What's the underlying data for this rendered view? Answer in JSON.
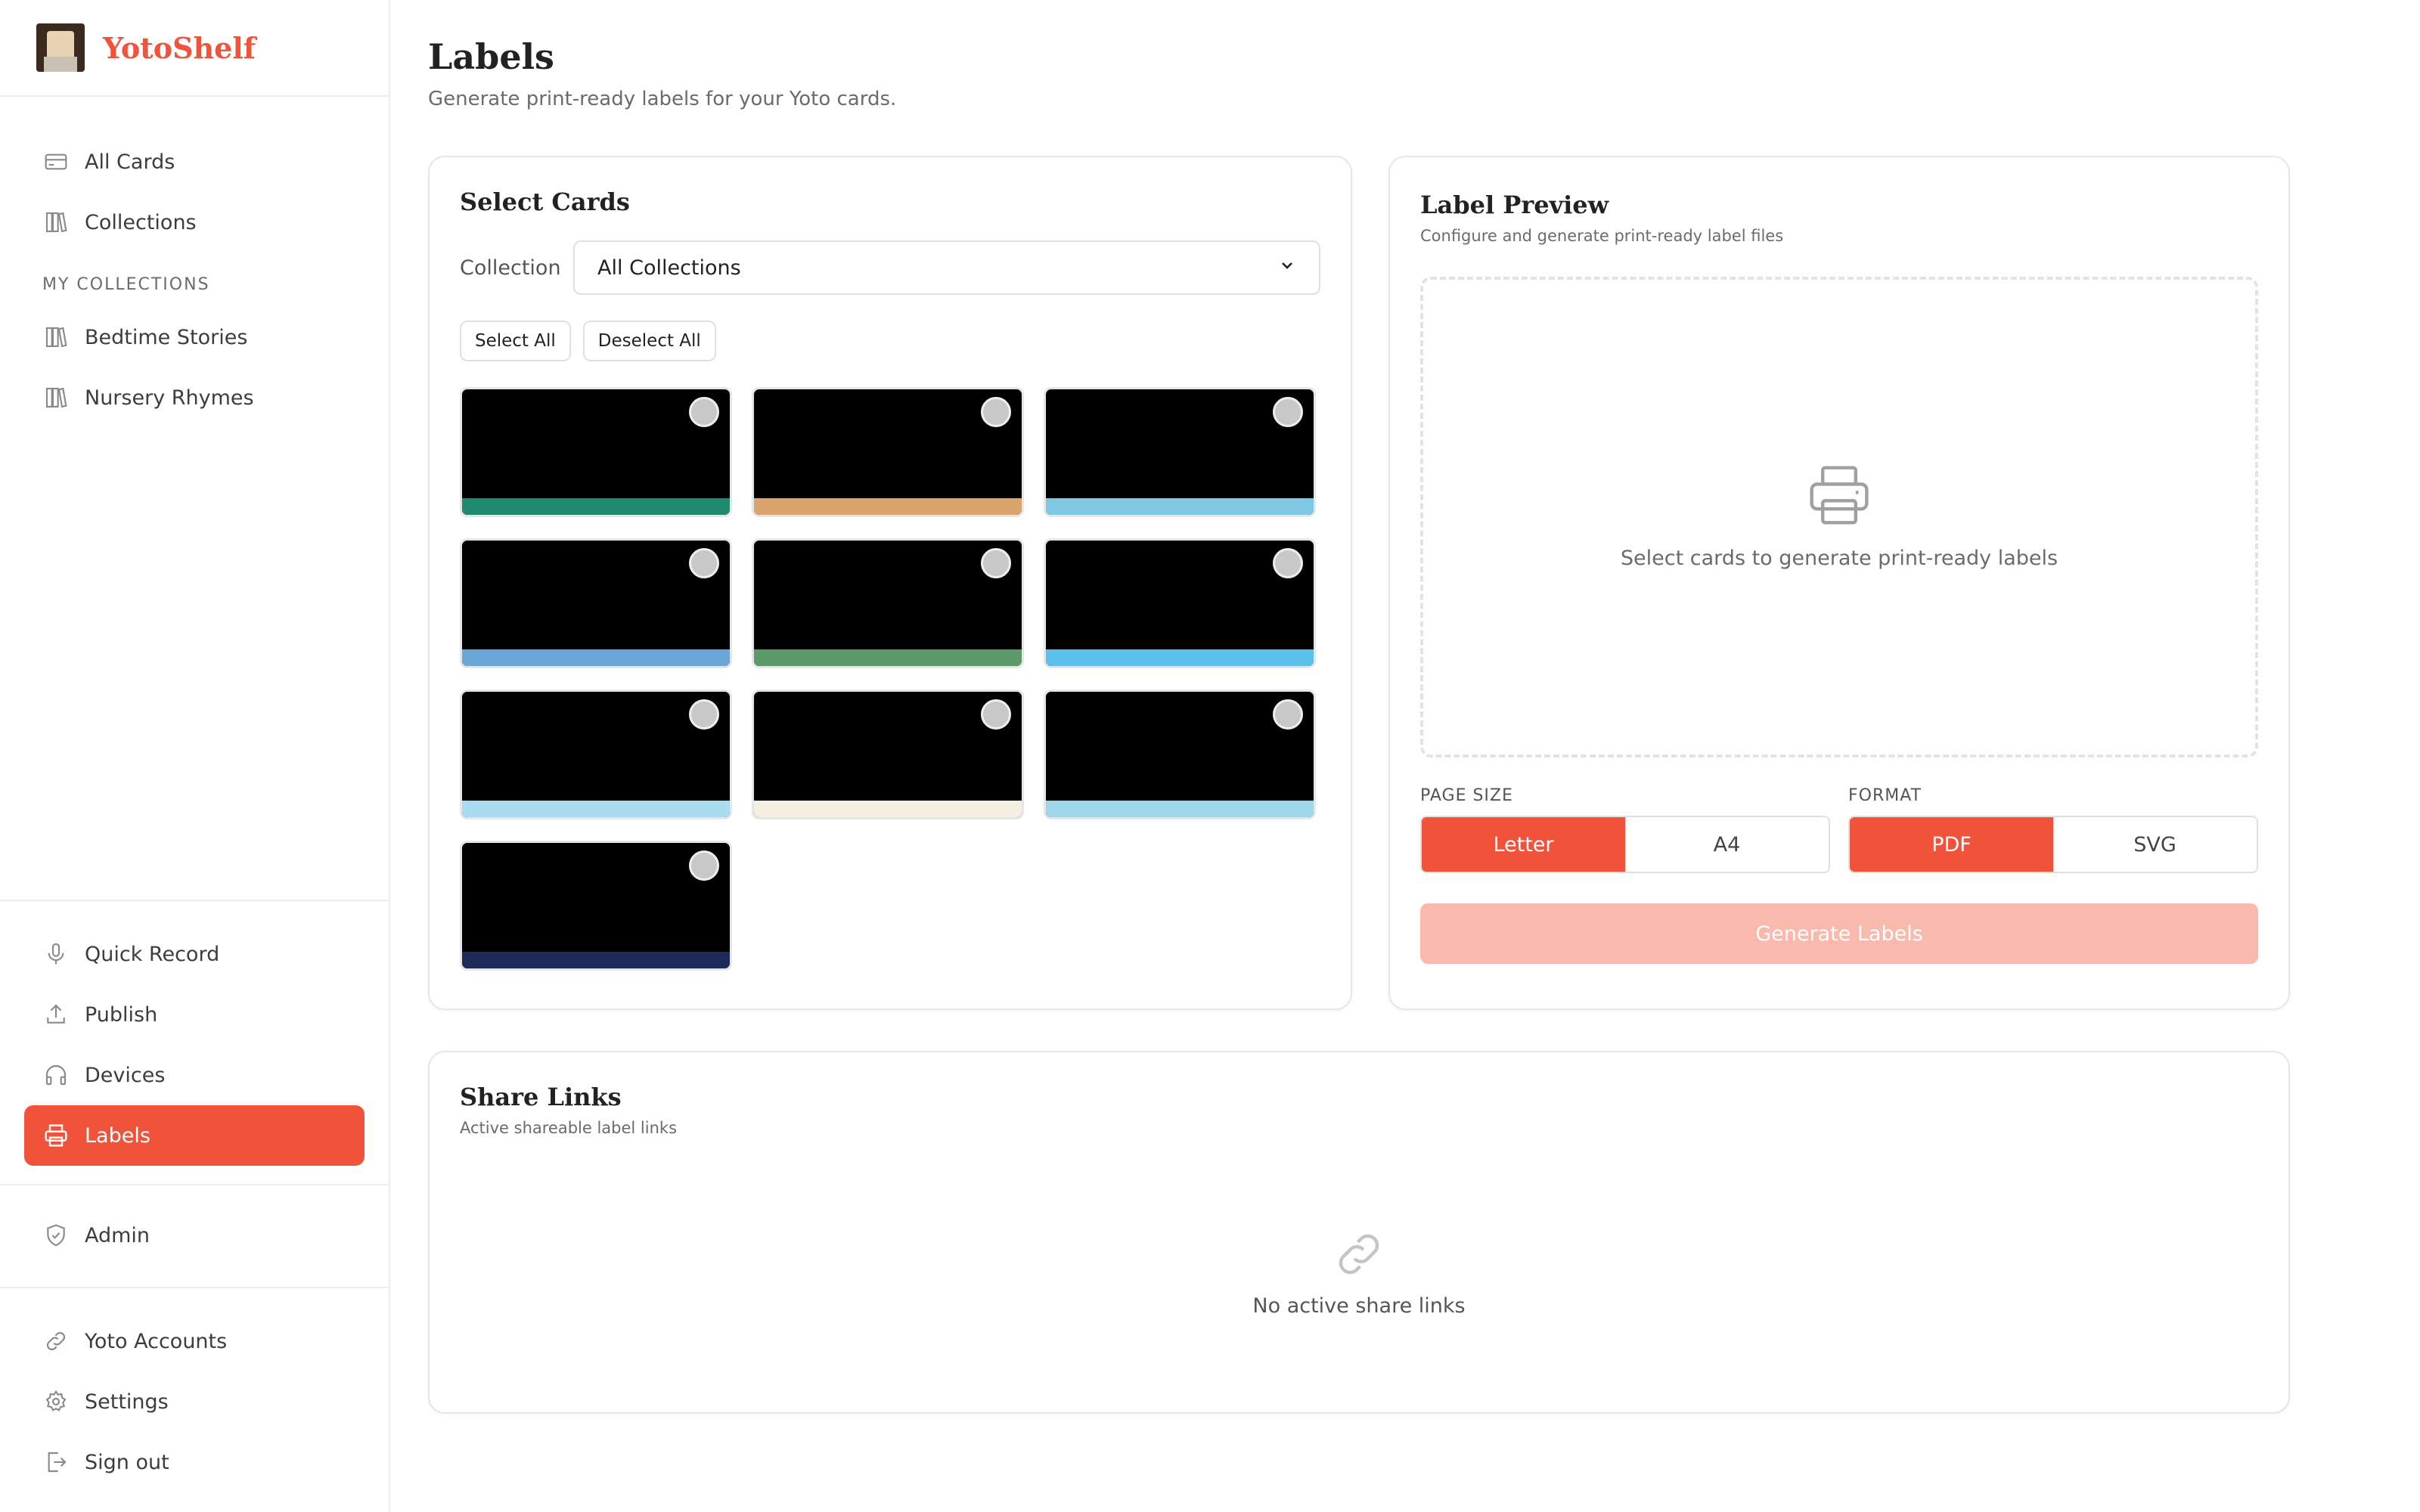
{
  "app": {
    "name": "YotoShelf"
  },
  "sidebar": {
    "top_items": [
      {
        "label": "All Cards",
        "icon": "card-icon"
      },
      {
        "label": "Collections",
        "icon": "books-icon"
      }
    ],
    "section_label": "MY COLLECTIONS",
    "collections": [
      {
        "label": "Bedtime Stories",
        "icon": "books-icon"
      },
      {
        "label": "Nursery Rhymes",
        "icon": "books-icon"
      }
    ],
    "tools": [
      {
        "label": "Quick Record",
        "icon": "microphone-icon"
      },
      {
        "label": "Publish",
        "icon": "upload-icon"
      },
      {
        "label": "Devices",
        "icon": "headphones-icon"
      },
      {
        "label": "Labels",
        "icon": "printer-icon",
        "active": true
      }
    ],
    "admin": {
      "label": "Admin",
      "icon": "shield-icon"
    },
    "account": [
      {
        "label": "Yoto Accounts",
        "icon": "link-icon"
      },
      {
        "label": "Settings",
        "icon": "gear-icon"
      },
      {
        "label": "Sign out",
        "icon": "sign-out-icon"
      }
    ]
  },
  "header": {
    "title": "Labels",
    "subtitle": "Generate print-ready labels for your Yoto cards."
  },
  "select_cards": {
    "title": "Select Cards",
    "collection_label": "Collection",
    "collection_value": "All Collections",
    "select_all": "Select All",
    "deselect_all": "Deselect All",
    "thumb_strip_colors": [
      "#1f8a6e",
      "#d9a56c",
      "#7ec8e3",
      "#6aa6d8",
      "#5c9a6a",
      "#5bc0eb",
      "#a9dcef",
      "#f4efe0",
      "#9fd6ea",
      "#1e2a5a"
    ]
  },
  "preview": {
    "title": "Label Preview",
    "subtitle": "Configure and generate print-ready label files",
    "empty_message": "Select cards to generate print-ready labels",
    "page_size_label": "PAGE SIZE",
    "page_sizes": [
      "Letter",
      "A4"
    ],
    "page_size_selected": "Letter",
    "format_label": "FORMAT",
    "formats": [
      "PDF",
      "SVG"
    ],
    "format_selected": "PDF",
    "generate_label": "Generate Labels"
  },
  "share": {
    "title": "Share Links",
    "subtitle": "Active shareable label links",
    "empty_message": "No active share links"
  },
  "colors": {
    "accent": "#f0533a",
    "accent_disabled": "#f9b9ad"
  }
}
